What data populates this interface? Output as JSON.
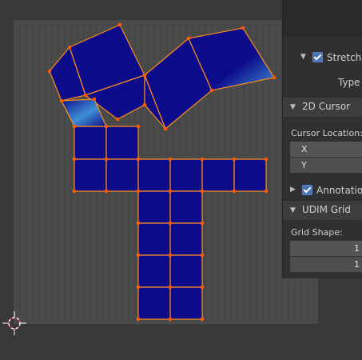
{
  "uv_editor": {
    "background": "#393939",
    "uv_area_color": "#4a4a4a",
    "face_color_deep": "#0c0c8a",
    "face_color_stretched": "#3f8fd6",
    "edge_color": "#ff8c1a",
    "vertex_color": "#ff5a00",
    "cursor_icon": "2d-cursor-icon"
  },
  "sidebar": {
    "stretching": {
      "label": "Stretching",
      "checked": true,
      "icon": "chevron-down-icon"
    },
    "type_label": "Type",
    "cursor_panel": {
      "title": "2D Cursor",
      "icon": "chevron-down-icon"
    },
    "cursor_location_label": "Cursor Location:",
    "x_label": "X",
    "y_label": "Y",
    "annotations": {
      "label": "Annotations",
      "checked": true,
      "icon": "chevron-right-icon"
    },
    "udim_panel": {
      "title": "UDIM Grid",
      "icon": "chevron-down-icon"
    },
    "grid_shape_label": "Grid Shape:",
    "grid_shape_x": "1",
    "grid_shape_y": "1"
  }
}
